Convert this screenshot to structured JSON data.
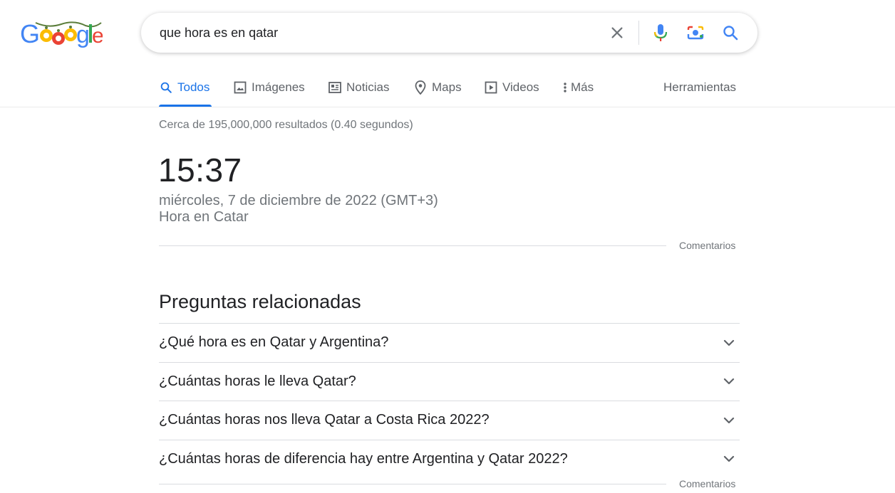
{
  "search": {
    "query": "que hora es en qatar"
  },
  "tabs": [
    {
      "label": "Todos",
      "icon": "search-icon",
      "active": true
    },
    {
      "label": "Imágenes",
      "icon": "image-icon"
    },
    {
      "label": "Noticias",
      "icon": "news-icon"
    },
    {
      "label": "Maps",
      "icon": "map-pin-icon"
    },
    {
      "label": "Videos",
      "icon": "play-icon"
    },
    {
      "label": "Más",
      "icon": "more-vert-icon"
    }
  ],
  "tools_label": "Herramientas",
  "result_stats": "Cerca de 195,000,000 resultados (0.40 segundos)",
  "clock": {
    "time": "15:37",
    "date": "miércoles, 7 de diciembre de 2022 (GMT+3)",
    "place": "Hora en Catar",
    "feedback": "Comentarios"
  },
  "related": {
    "title": "Preguntas relacionadas",
    "questions": [
      "¿Qué hora es en Qatar y Argentina?",
      "¿Cuántas horas le lleva Qatar?",
      "¿Cuántas horas nos lleva Qatar a Costa Rica 2022?",
      "¿Cuántas horas de diferencia hay entre Argentina y Qatar 2022?"
    ],
    "feedback": "Comentarios"
  },
  "colors": {
    "blue": "#1a73e8",
    "google_blue": "#4285f4",
    "google_red": "#ea4335",
    "google_yellow": "#fbbc05",
    "google_green": "#34a853"
  }
}
